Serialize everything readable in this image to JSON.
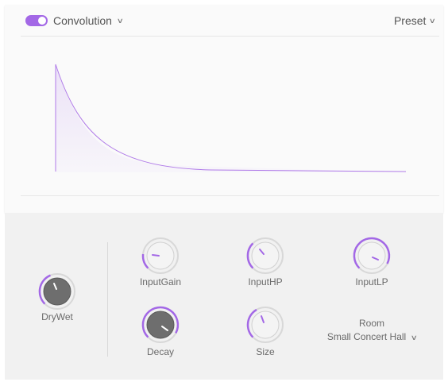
{
  "header": {
    "effect_name": "Convolution",
    "preset_label": "Preset",
    "enabled": true
  },
  "colors": {
    "accent": "#a368e6",
    "knob_dark": "#6e6e6e",
    "knob_light": "#f4f4f4"
  },
  "icons": {
    "effect_dropdown": "chevron-down-icon",
    "preset_dropdown": "chevron-down-icon",
    "room_dropdown": "chevron-down-icon"
  },
  "knobs": [
    {
      "id": "drywet",
      "label": "DryWet",
      "style": "dark"
    },
    {
      "id": "inputgain",
      "label": "InputGain",
      "style": "light"
    },
    {
      "id": "inputhp",
      "label": "InputHP",
      "style": "light"
    },
    {
      "id": "inputlp",
      "label": "InputLP",
      "style": "light"
    },
    {
      "id": "decay",
      "label": "Decay",
      "style": "dark"
    },
    {
      "id": "size",
      "label": "Size",
      "style": "light"
    }
  ],
  "room": {
    "label": "Room",
    "value": "Small Concert Hall"
  }
}
